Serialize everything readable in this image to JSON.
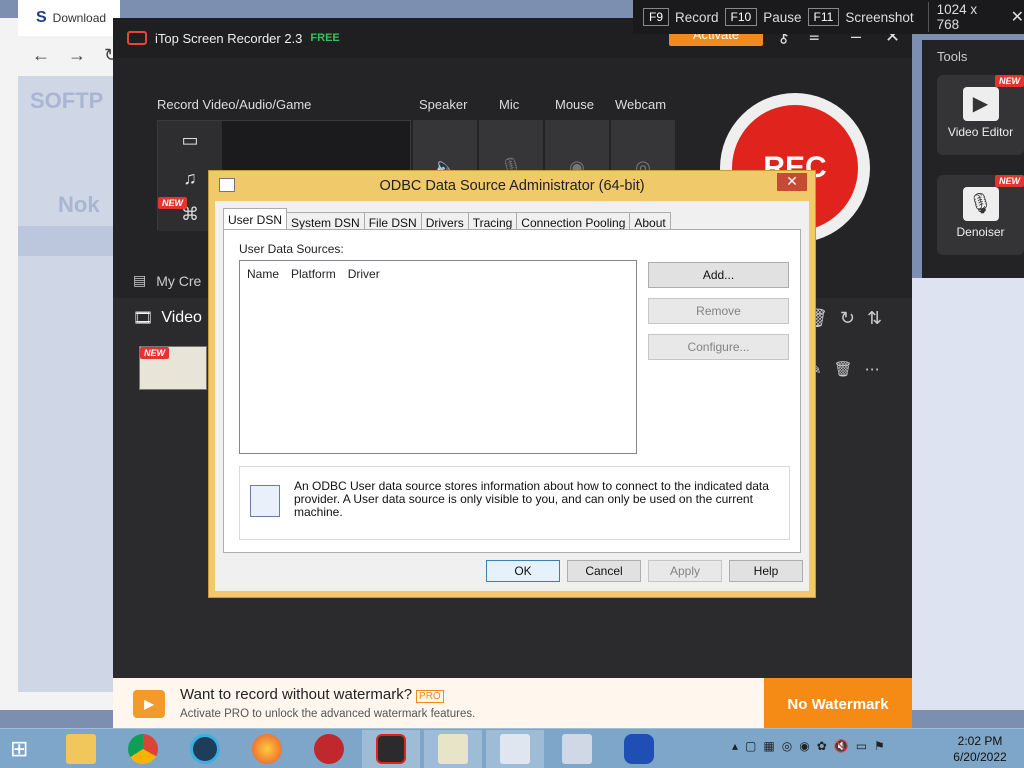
{
  "browser": {
    "tab_label": "Download",
    "brand": "SOFTP",
    "page_text_1": "Nok"
  },
  "recorder": {
    "title": "iTop Screen Recorder 2.3",
    "free": "FREE",
    "activate": "Activate",
    "section_record": "Record Video/Audio/Game",
    "devices": [
      "Speaker",
      "Mic",
      "Mouse",
      "Webcam"
    ],
    "rec_button": "REC",
    "my_creations": "My Cre",
    "video_label": "Video",
    "new_tag": "NEW",
    "watermark": {
      "title": "Want to record without watermark?",
      "pro": "PRO",
      "subtitle": "Activate PRO to unlock the advanced watermark features.",
      "button": "No Watermark"
    }
  },
  "hotkeys": {
    "items": [
      {
        "key": "F9",
        "label": "Record"
      },
      {
        "key": "F10",
        "label": "Pause"
      },
      {
        "key": "F11",
        "label": "Screenshot"
      }
    ],
    "resolution": "1024 x 768",
    "close": "✕"
  },
  "tools": {
    "label": "Tools",
    "items": [
      {
        "name": "Video Editor",
        "badge": "NEW"
      },
      {
        "name": "Denoiser",
        "badge": "NEW"
      }
    ]
  },
  "dialog": {
    "title": "ODBC Data Source Administrator (64-bit)",
    "close": "✕",
    "tabs": [
      "User DSN",
      "System DSN",
      "File DSN",
      "Drivers",
      "Tracing",
      "Connection Pooling",
      "About"
    ],
    "list_label": "User Data Sources:",
    "columns": [
      "Name",
      "Platform",
      "Driver"
    ],
    "side_buttons": {
      "add": "Add...",
      "remove": "Remove",
      "configure": "Configure..."
    },
    "info": "An ODBC User data source stores information about how to connect to the indicated data provider.   A User data source is only visible to you, and can only be used on the current machine.",
    "buttons": {
      "ok": "OK",
      "cancel": "Cancel",
      "apply": "Apply",
      "help": "Help"
    }
  },
  "taskbar": {
    "time": "2:02 PM",
    "date": "6/20/2022"
  },
  "colors": {
    "accent_orange": "#f58b15",
    "rec_red": "#e0231d",
    "dialog_frame": "#f0c96a"
  }
}
